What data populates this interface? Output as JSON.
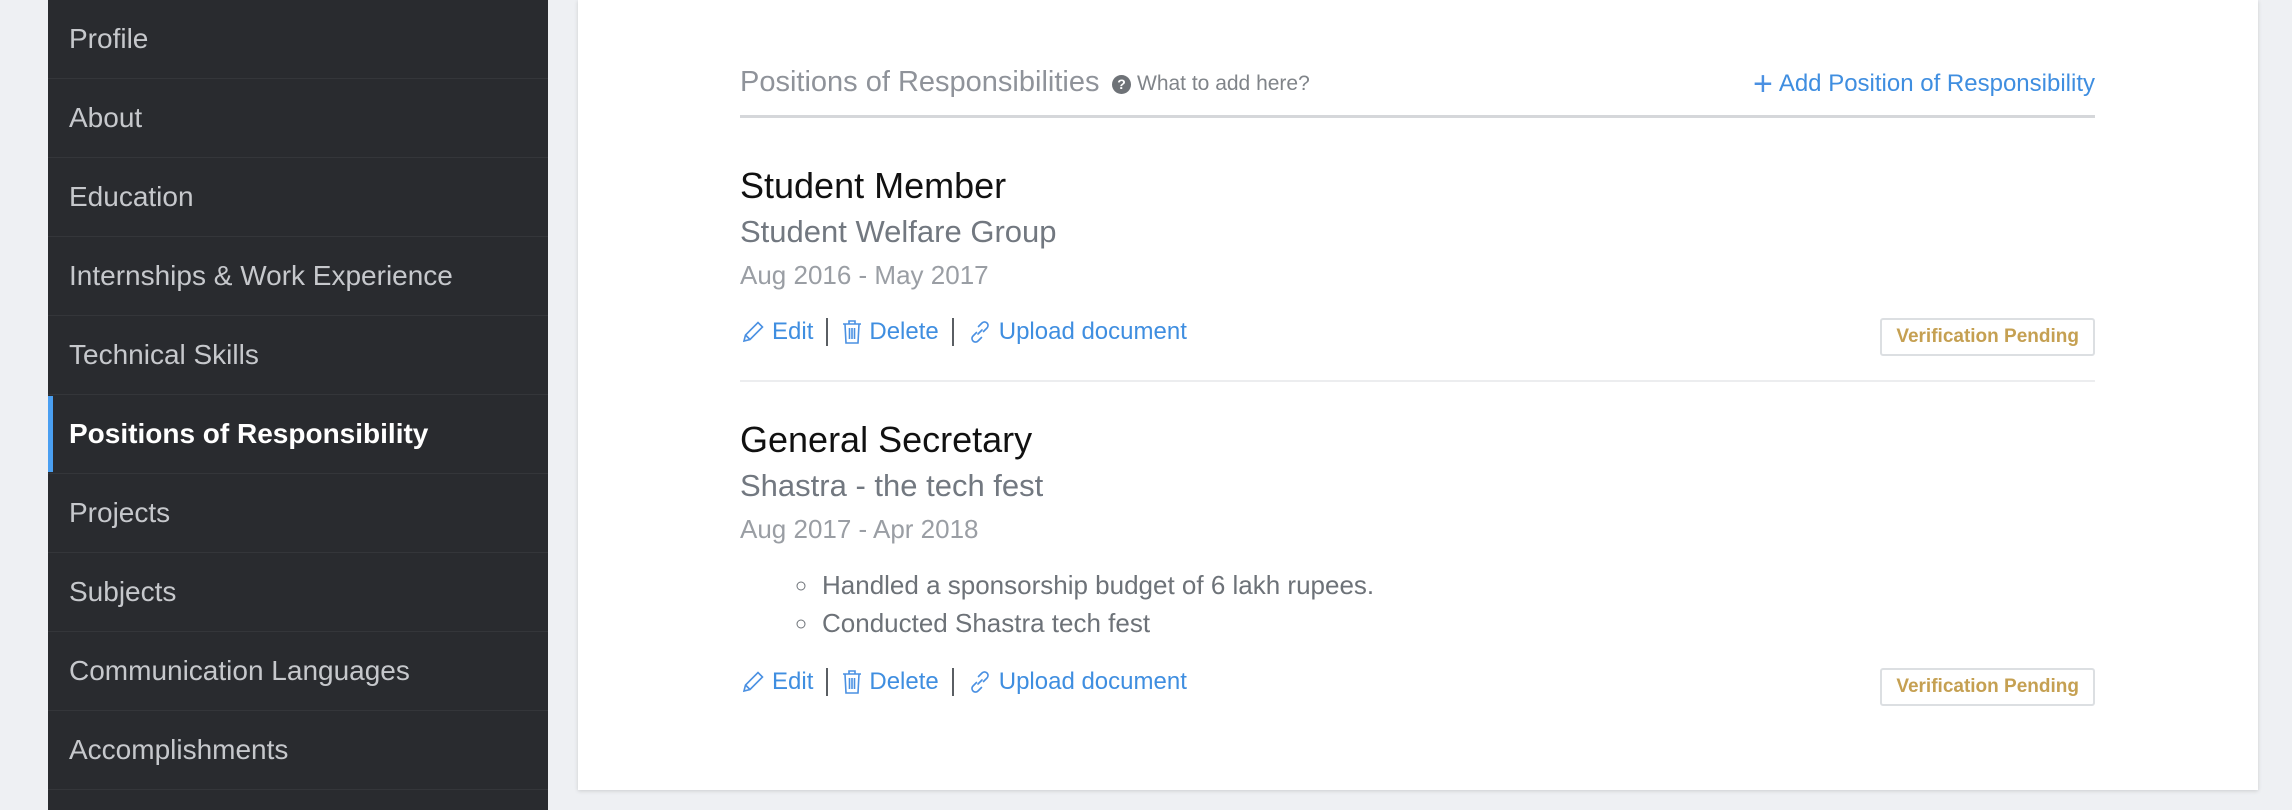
{
  "sidebar": {
    "items": [
      {
        "label": "Profile"
      },
      {
        "label": "About"
      },
      {
        "label": "Education"
      },
      {
        "label": "Internships & Work Experience"
      },
      {
        "label": "Technical Skills"
      },
      {
        "label": "Positions of Responsibility",
        "active": true
      },
      {
        "label": "Projects"
      },
      {
        "label": "Subjects"
      },
      {
        "label": "Communication Languages"
      },
      {
        "label": "Accomplishments"
      }
    ]
  },
  "section": {
    "title": "Positions of Responsibilities",
    "help_text": "What to add here?",
    "add_label": "Add Position of Responsibility"
  },
  "entries": [
    {
      "title": "Student Member",
      "org": "Student Welfare Group",
      "date": "Aug 2016 - May 2017",
      "bullets": [],
      "edit": "Edit",
      "delete": "Delete",
      "upload": "Upload document",
      "status": "Verification Pending"
    },
    {
      "title": "General Secretary",
      "org": "Shastra - the tech fest",
      "date": "Aug 2017 - Apr 2018",
      "bullets": [
        "Handled a sponsorship budget of 6 lakh rupees.",
        "Conducted Shastra tech fest"
      ],
      "edit": "Edit",
      "delete": "Delete",
      "upload": "Upload document",
      "status": "Verification Pending"
    }
  ],
  "colors": {
    "sidebar_bg": "#292b2f",
    "accent": "#4a9ff1",
    "link": "#3f8ee0",
    "badge_text": "#c5a052"
  }
}
